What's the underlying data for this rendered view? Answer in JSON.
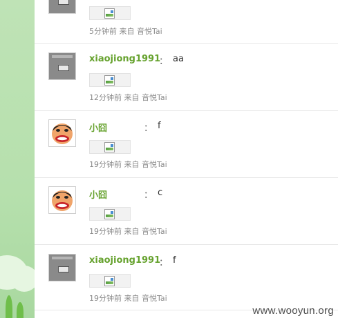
{
  "feed": {
    "items": [
      {
        "avatar": "screen-avatar-icon",
        "name": "",
        "message": "",
        "time": "5分钟前",
        "from_label": "来自",
        "source": "音悦Tai"
      },
      {
        "avatar": "screen-avatar-icon",
        "name": "xiaojiong1991",
        "message": "aa",
        "time": "12分钟前",
        "from_label": "来自",
        "source": "音悦Tai"
      },
      {
        "avatar": "cartoon-face-avatar",
        "name": "小囧",
        "message": "f",
        "time": "19分钟前",
        "from_label": "来自",
        "source": "音悦Tai"
      },
      {
        "avatar": "cartoon-face-avatar",
        "name": "小囧",
        "message": "c",
        "time": "19分钟前",
        "from_label": "来自",
        "source": "音悦Tai"
      },
      {
        "avatar": "screen-avatar-icon",
        "name": "xiaojiong1991",
        "message": "f",
        "time": "19分钟前",
        "from_label": "来自",
        "source": "音悦Tai"
      }
    ],
    "separator": "："
  },
  "colors": {
    "username": "#66a22e",
    "meta": "#8a8a8a",
    "sidebar_bg": "#bfe3b6"
  },
  "watermark": "www.wooyun.org"
}
